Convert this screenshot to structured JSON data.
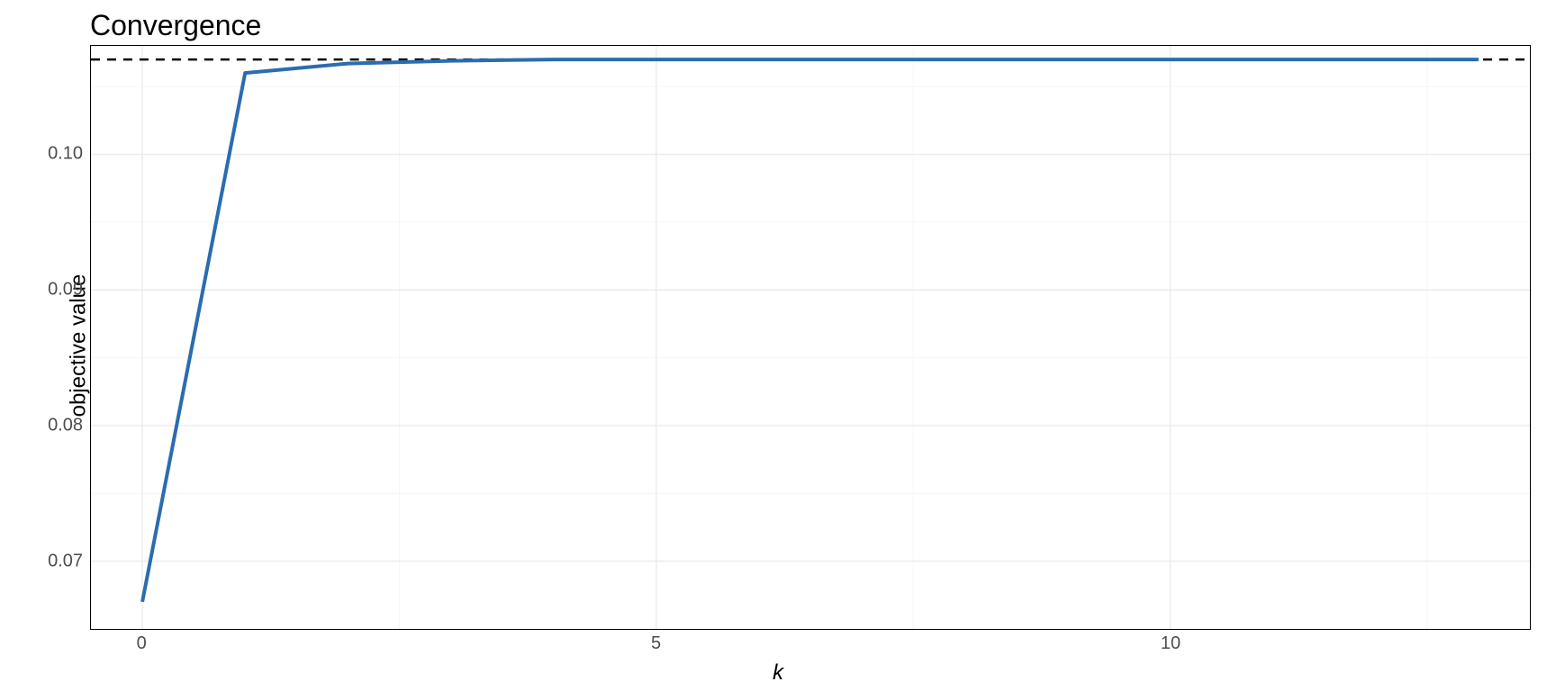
{
  "chart_data": {
    "type": "line",
    "title": "Convergence",
    "xlabel": "k",
    "ylabel": "objective value",
    "x": [
      0,
      1,
      2,
      3,
      4,
      5,
      6,
      7,
      8,
      9,
      10,
      11,
      12,
      13
    ],
    "y": [
      0.067,
      0.106,
      0.1067,
      0.1069,
      0.107,
      0.107,
      0.107,
      0.107,
      0.107,
      0.107,
      0.107,
      0.107,
      0.107,
      0.107
    ],
    "hline": 0.107,
    "xlim": [
      -0.5,
      13.5
    ],
    "ylim": [
      0.065,
      0.108
    ],
    "xticks": [
      0,
      5,
      10
    ],
    "yticks": [
      0.07,
      0.08,
      0.09,
      0.1
    ],
    "line_color": "#2b6cb0",
    "hline_style": "dashed"
  }
}
